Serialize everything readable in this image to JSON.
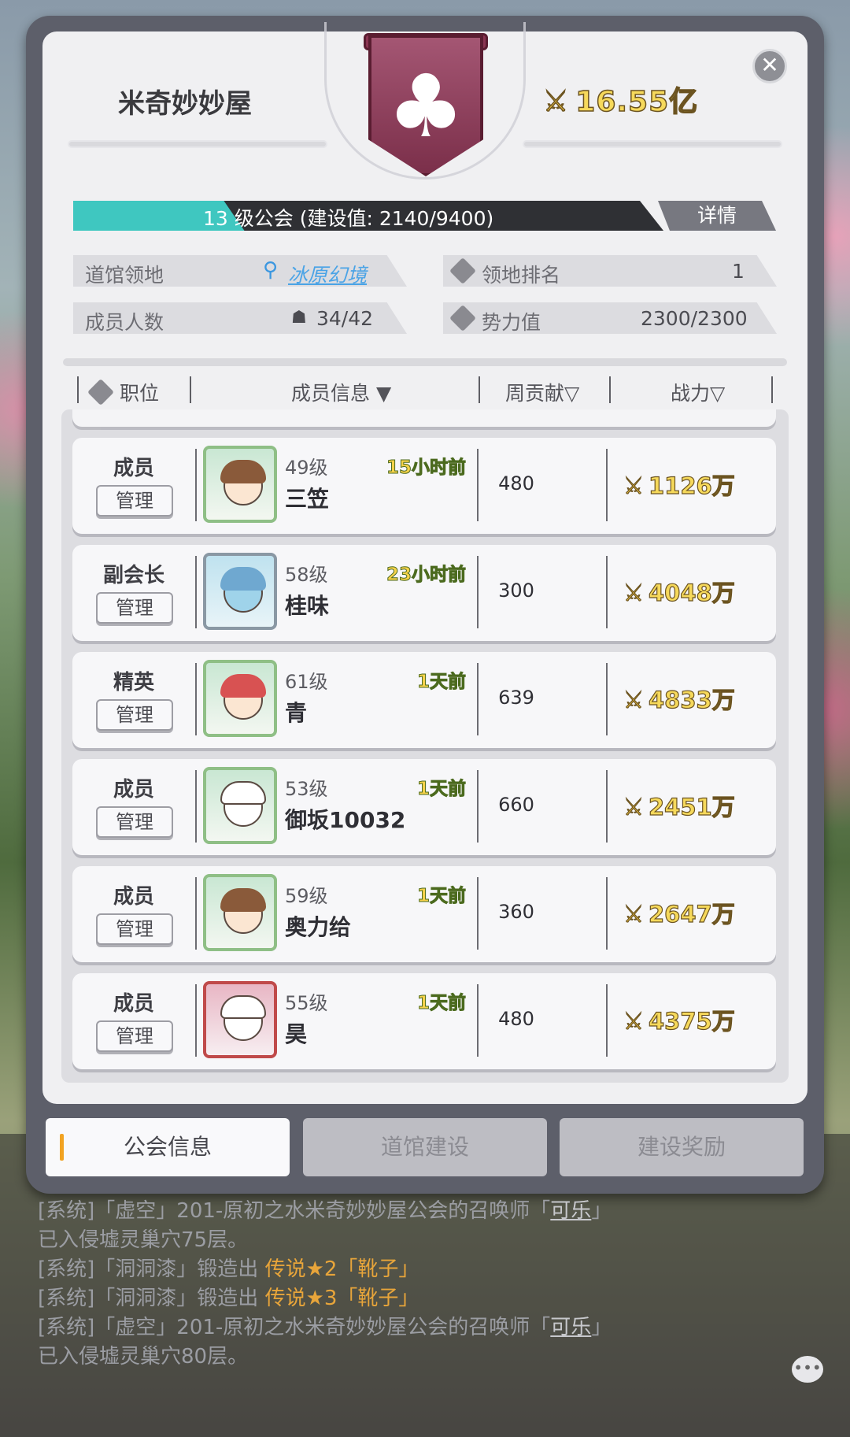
{
  "guild": {
    "name": "米奇妙妙屋",
    "total_power": "16.55亿",
    "level_text": "13 级公会 (建设值:  2140/9400)",
    "level_progress": 0.2277,
    "detail_label": "详情"
  },
  "info": {
    "territory_label": "道馆领地",
    "territory_value": "冰原幻境",
    "rank_label": "领地排名",
    "rank_value": "1",
    "members_label": "成员人数",
    "members_value": "34/42",
    "influence_label": "势力值",
    "influence_value": "2300/2300"
  },
  "table": {
    "headers": {
      "position": "职位",
      "member_info": "成员信息 ▼",
      "weekly": "周贡献▽",
      "power": "战力▽"
    },
    "manage_label": "管理",
    "rows": [
      {
        "role": "成员",
        "level": "49级",
        "name": "三笠",
        "online": "15小时前",
        "weekly": "480",
        "power": "1126万",
        "avatar": "brown-hair-boy"
      },
      {
        "role": "副会长",
        "level": "58级",
        "name": "桂味",
        "online": "23小时前",
        "weekly": "300",
        "power": "4048万",
        "avatar": "blue-dragon"
      },
      {
        "role": "精英",
        "level": "61级",
        "name": "青",
        "online": "1天前",
        "weekly": "639",
        "power": "4833万",
        "avatar": "red-hat-girl"
      },
      {
        "role": "成员",
        "level": "53级",
        "name": "御坂10032",
        "online": "1天前",
        "weekly": "660",
        "power": "2451万",
        "avatar": "white-bunny"
      },
      {
        "role": "成员",
        "level": "59级",
        "name": "奥力给",
        "online": "1天前",
        "weekly": "360",
        "power": "2647万",
        "avatar": "brown-hair-boy"
      },
      {
        "role": "成员",
        "level": "55级",
        "name": "昊",
        "online": "1天前",
        "weekly": "480",
        "power": "4375万",
        "avatar": "white-bunny-red-frame"
      }
    ]
  },
  "tabs": {
    "guild_info": "公会信息",
    "dojo_build": "道馆建设",
    "build_reward": "建设奖励"
  },
  "chat": {
    "line1a": "[系统]「虚空」201-原初之水米奇妙妙屋公会的召唤师「",
    "line1_name": "可乐",
    "line1b": "」",
    "line1c": "已入侵墟灵巢穴75层。",
    "line2a": "[系统]「洞洞漆」锻造出 ",
    "line2_item": "传说★2「靴子」",
    "line3a": "[系统]「洞洞漆」锻造出 ",
    "line3_item": "传说★3「靴子」",
    "line4a": "[系统]「虚空」201-原初之水米奇妙妙屋公会的召唤师「",
    "line4_name": "可乐",
    "line4b": "」",
    "line4c": "已入侵墟灵巢穴80层。"
  },
  "colors": {
    "level_fill": "#3fc7c0",
    "power_gold": "#f6d95b",
    "emblem": "#7b2f4a",
    "tab_marker": "#f2a322",
    "chat_highlight": "#e8a53a"
  },
  "icons": {
    "close": "close-icon",
    "emblem": "club-suit-icon",
    "swords": "crossed-swords-icon",
    "pin": "location-pin-icon",
    "person": "person-icon",
    "diamond": "diamond-icon",
    "chat": "chat-bubble-icon"
  }
}
